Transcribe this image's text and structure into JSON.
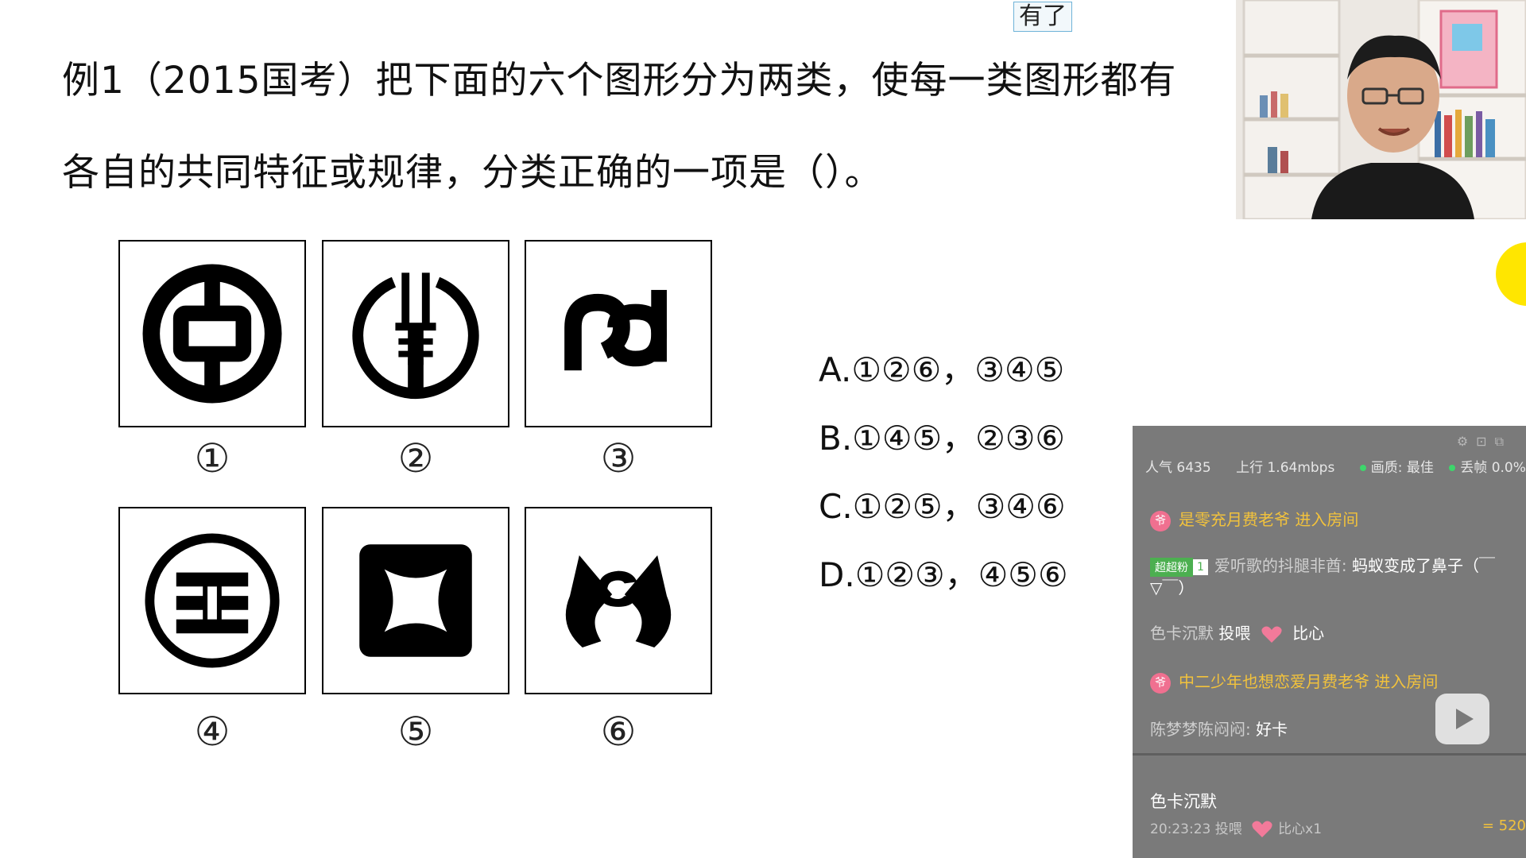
{
  "question": {
    "line1": "例1（2015国考）把下面的六个图形分为两类，使每一类图形都有",
    "line2": "各自的共同特征或规律，分类正确的一项是（）。"
  },
  "tag_text": "有了",
  "figures": {
    "labels": [
      "①",
      "②",
      "③",
      "④",
      "⑤",
      "⑥"
    ]
  },
  "options": [
    "A.①②⑥，③④⑤",
    "B.①④⑤，②③⑥",
    "C.①②⑤，③④⑥",
    "D.①②③，④⑤⑥"
  ],
  "chat": {
    "stats": {
      "popularity": "人气 6435",
      "upload": "上行 1.64mbps",
      "quality": "画质: 最佳",
      "drop": "丢帧 0.0%"
    },
    "messages": [
      {
        "user": "是零充月费老爷",
        "action": " 进入房间"
      },
      {
        "fan_badge": "超超粉",
        "fan_level": "1",
        "user": "爱听歌的抖腿非酋:",
        "text": " 蚂蚁变成了鼻子（￣",
        "text2": "▽￣）"
      },
      {
        "user": "色卡沉默",
        "action": " 投喂",
        "gift": " 比心"
      },
      {
        "user": "中二少年也想恋爱月费老爷",
        "action": " 进入房间"
      },
      {
        "user": "陈梦梦陈闷闷:",
        "text": " 好卡"
      }
    ],
    "gift_panel": {
      "user": "色卡沉默",
      "time": "20:23:23 投喂",
      "gift": "比心x1",
      "coin": "= 520"
    }
  },
  "colors": {
    "chat_bg": "#7a7a7a",
    "enter_text": "#f2c23c",
    "fan_badge": "#4caf50",
    "yellow_dot": "#ffe600"
  }
}
